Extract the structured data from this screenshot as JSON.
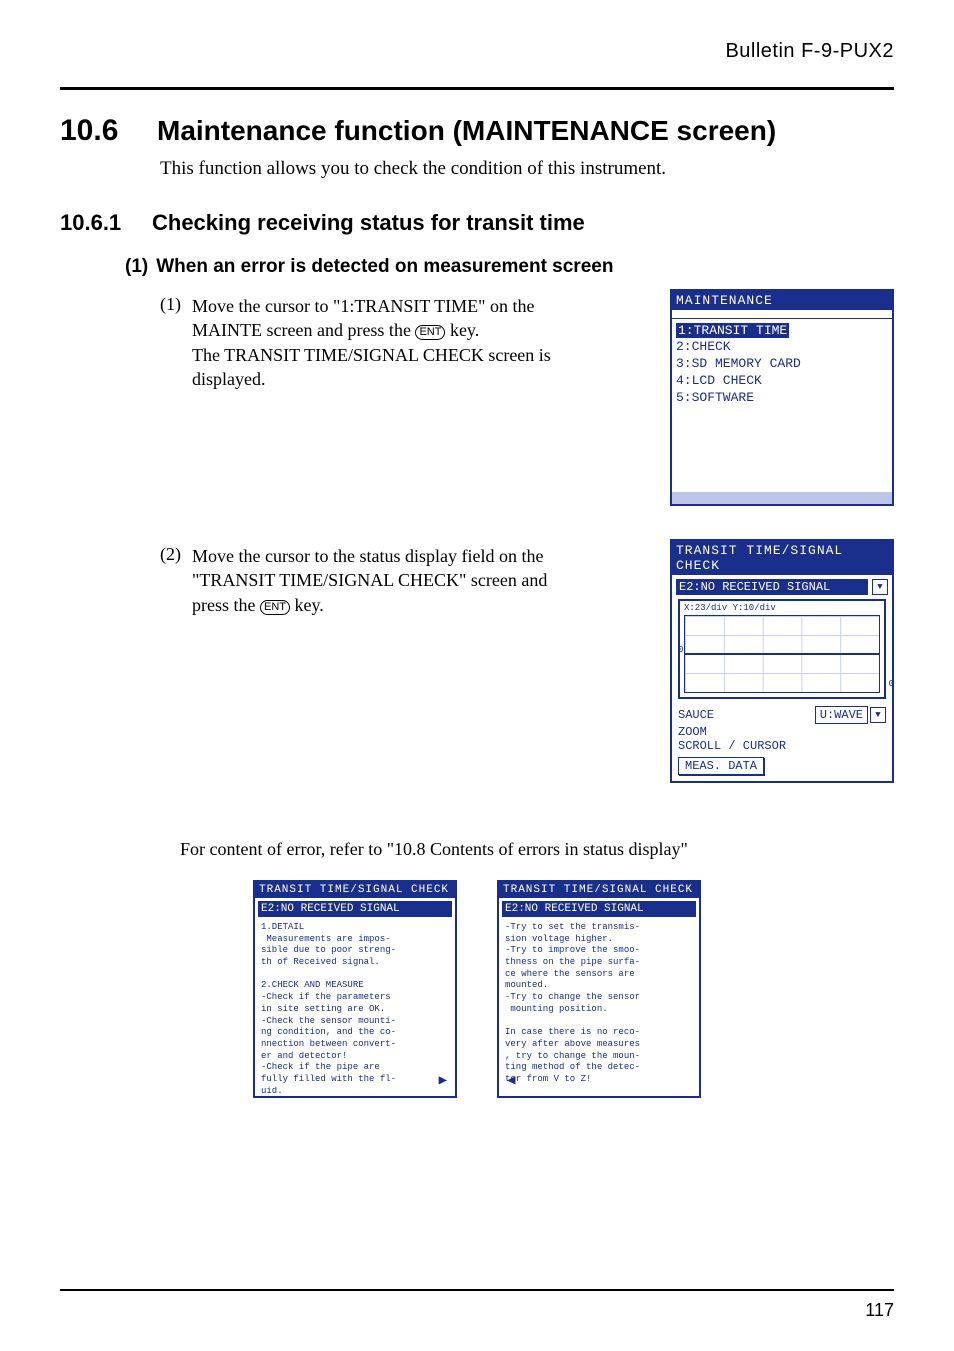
{
  "bulletin": "Bulletin F-9-PUX2",
  "section": {
    "number": "10.6",
    "title": "Maintenance function (MAINTENANCE screen)",
    "description": "This function allows you to check the condition of this instrument."
  },
  "subsection": {
    "number": "10.6.1",
    "title": "Checking receiving status for transit time"
  },
  "item": {
    "number": "(1)",
    "title": "When an error is detected on measurement screen"
  },
  "step1": {
    "num": "(1)",
    "t1": "Move the cursor to \"1:TRANSIT TIME\" on the MAINTE screen and press the",
    "t2": "key.",
    "t3": "The TRANSIT TIME/SIGNAL CHECK screen is displayed."
  },
  "step2": {
    "num": "(2)",
    "t1": "Move the cursor to the status display field on the \"TRANSIT TIME/SIGNAL CHECK\" screen and press the",
    "t2": "key."
  },
  "ent_label": "ENT",
  "maint_lcd": {
    "title": "MAINTENANCE",
    "items": [
      "1:TRANSIT TIME",
      "2:CHECK",
      "3:SD MEMORY CARD",
      "4:LCD CHECK",
      "5:SOFTWARE"
    ],
    "selected_index": 0
  },
  "signal_lcd": {
    "title": "TRANSIT TIME/SIGNAL CHECK",
    "status": "E2:NO RECEIVED SIGNAL",
    "axis": "X:23/div Y:10/div",
    "zero": "0",
    "rows": {
      "sauce": "SAUCE",
      "wave_label": "U:WAVE",
      "zoom": "ZOOM",
      "scroll": "SCROLL / CURSOR",
      "meas": "MEAS. DATA"
    }
  },
  "refer": "For content of error, refer to \"10.8 Contents of errors in status display\"",
  "detail_lcd_left": {
    "title": "TRANSIT TIME/SIGNAL CHECK",
    "status": "E2:NO RECEIVED SIGNAL",
    "body": "1.DETAIL\n Measurements are impos-\nsible due to poor streng-\nth of Received signal.\n\n2.CHECK AND MEASURE\n-Check if the parameters\nin site setting are OK.\n-Check the sensor mounti-\nng condition, and the co-\nnnection between convert-\ner and detector!\n-Check if the pipe are\nfully filled with the fl-\nuid."
  },
  "detail_lcd_right": {
    "title": "TRANSIT TIME/SIGNAL CHECK",
    "status": "E2:NO RECEIVED SIGNAL",
    "body": "-Try to set the transmis-\nsion voltage higher.\n-Try to improve the smoo-\nthness on the pipe surfa-\nce where the sensors are\nmounted.\n-Try to change the sensor\n mounting position.\n\nIn case there is no reco-\nvery after above measures\n, try to change the moun-\nting method of the detec-\ntor from V to Z!"
  },
  "page_number": "117"
}
